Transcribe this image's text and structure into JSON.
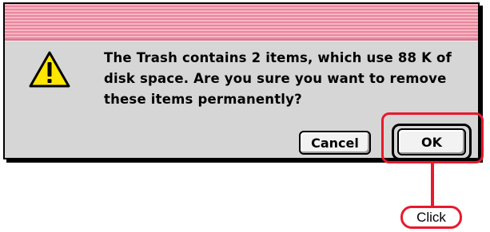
{
  "dialog": {
    "message": "The Trash contains 2 items, which use 88 K of disk space. Are you sure you want to remove these items permanently?",
    "icon": "caution-icon",
    "buttons": {
      "cancel_label": "Cancel",
      "ok_label": "OK"
    }
  },
  "annotation": {
    "callout_label": "Click",
    "color": "#e8192c"
  },
  "colors": {
    "titlebar_light": "#f7b6c5",
    "titlebar_dark": "#e9879d",
    "dialog_body": "#d6d6d6"
  }
}
